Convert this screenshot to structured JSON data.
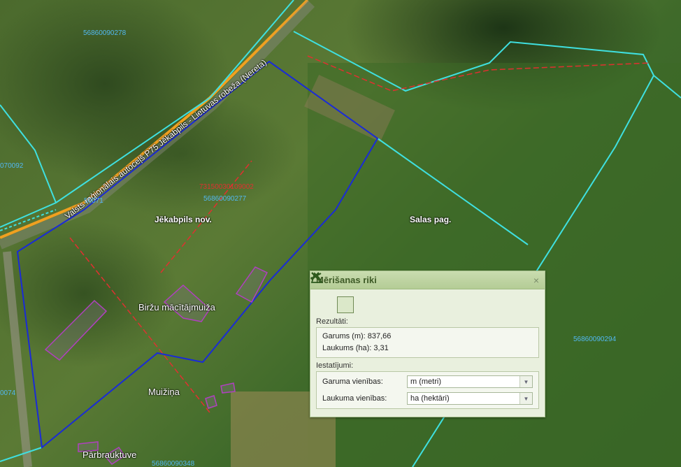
{
  "map": {
    "road_label": "Valsts reģionālais autoceļš P75 Jēkabpils - Lietuvas robeža (Nereta)",
    "regions": {
      "left": "Jēkabpils nov.",
      "right": "Salas pag."
    },
    "places": {
      "manor": "Biržu mācītājmuiža",
      "muiza": "Muižiņa",
      "crossing": "Pārbrauktuve"
    },
    "parcel_ids": {
      "top": "56860090278",
      "road_short": "50071",
      "center": "56860090277",
      "right": "56860090294",
      "bottom": "56860090348",
      "left_a": "070092",
      "left_b": "0074"
    },
    "cadastre_red": "73150030109002",
    "colors": {
      "parcel_line": "#3fe0e0",
      "selection": "#1a2bd6",
      "road": "#f0a020"
    }
  },
  "panel": {
    "title": "Mērišanas riki",
    "close": "×",
    "tools": [
      {
        "name": "line",
        "icon": "polyline-icon"
      },
      {
        "name": "area",
        "icon": "polygon-icon",
        "active": true
      },
      {
        "name": "clear",
        "icon": "close-icon"
      }
    ],
    "results_label": "Rezultāti:",
    "length": "Garums (m): 837,66",
    "area": "Laukums (ha): 3,31",
    "settings_label": "Iestatījumi:",
    "length_units_label": "Garuma vienības:",
    "length_units_value": "m (metri)",
    "area_units_label": "Laukuma vienības:",
    "area_units_value": "ha (hektāri)"
  }
}
